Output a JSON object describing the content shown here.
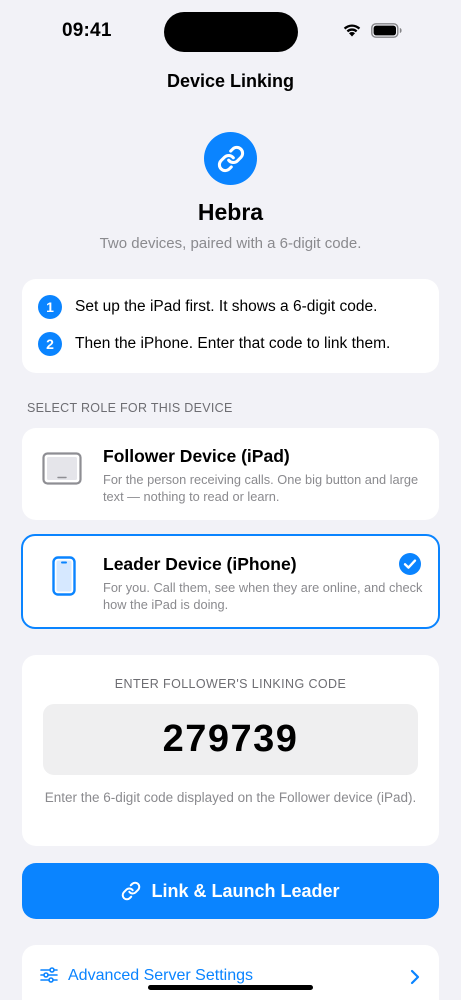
{
  "status_bar": {
    "time": "09:41"
  },
  "nav": {
    "title": "Device Linking"
  },
  "app": {
    "name": "Hebra",
    "tagline": "Two devices, paired with a 6-digit code.",
    "accent": "#0a84ff"
  },
  "steps": [
    {
      "number": "1",
      "text": "Set up the iPad first. It shows a 6-digit code."
    },
    {
      "number": "2",
      "text": "Then the iPhone. Enter that code to link them."
    }
  ],
  "role_section": {
    "label": "SELECT ROLE FOR THIS DEVICE",
    "roles": [
      {
        "title": "Follower Device (iPad)",
        "description": "For the person receiving calls. One big button and large text — nothing to read or learn.",
        "icon": "ipad-icon",
        "selected": false
      },
      {
        "title": "Leader Device (iPhone)",
        "description": "For you. Call them, see when they are online, and check how the iPad is doing.",
        "icon": "iphone-icon",
        "selected": true
      }
    ]
  },
  "code_entry": {
    "label": "ENTER FOLLOWER'S LINKING CODE",
    "value": "279739",
    "hint": "Enter the 6-digit code displayed on the Follower device (iPad)."
  },
  "primary_action": {
    "label": "Link & Launch Leader",
    "icon": "link-icon"
  },
  "advanced": {
    "label": "Advanced Server Settings",
    "icon": "sliders-icon"
  }
}
